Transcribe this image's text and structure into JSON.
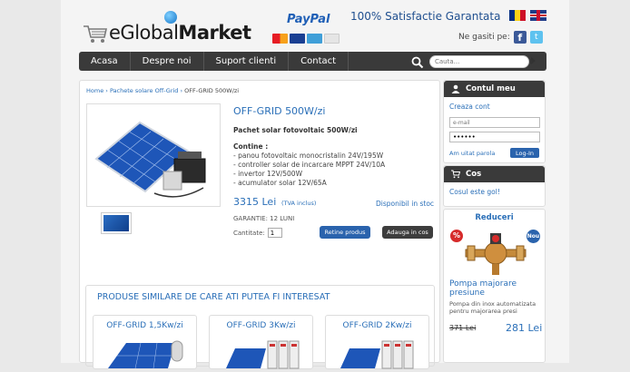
{
  "header": {
    "logo_part1": "eGlobal",
    "logo_part2": "Market",
    "paypal": "PayPal",
    "satisfaction": "100% Satisfactie Garantata",
    "social_label": "Ne gasiti pe:"
  },
  "nav": {
    "items": [
      "Acasa",
      "Despre noi",
      "Suport clienti",
      "Contact"
    ],
    "search_placeholder": "Cauta..."
  },
  "breadcrumb": {
    "home": "Home",
    "category": "Pachete solare Off-Grid",
    "current": "OFF-GRID 500W/zi"
  },
  "product": {
    "title": "OFF-GRID 500W/zi",
    "subtitle": "Pachet solar fotovoltaic 500W/zi",
    "contents_label": "Contine :",
    "contents": [
      "- panou fotovoltaic monocristalin 24V/195W",
      "- controller solar de incarcare MPPT 24V/10A",
      "- invertor 12V/500W",
      "- acumulator solar 12V/65A"
    ],
    "price": "3315 Lei",
    "vat_note": "(TVA inclus)",
    "stock": "Disponibil in stoc",
    "warranty": "GARANTIE: 12 LUNI",
    "quantity_label": "Cantitate:",
    "quantity_value": "1",
    "reserve_button": "Retine produs",
    "add_button": "Adauga in cos"
  },
  "similar": {
    "title": "PRODUSE SIMILARE DE CARE ATI PUTEA FI INTERESAT",
    "items": [
      "OFF-GRID 1,5Kw/zi",
      "OFF-GRID 3Kw/zi",
      "OFF-GRID 2Kw/zi"
    ]
  },
  "account": {
    "header": "Contul meu",
    "create": "Creaza cont",
    "email_placeholder": "e-mail",
    "password_value": "••••••",
    "forgot": "Am uitat parola",
    "login": "Log-In"
  },
  "cart": {
    "header": "Cos",
    "empty": "Cosul este gol!"
  },
  "offers": {
    "title": "Reduceri",
    "badge_pct": "%",
    "badge_new": "Nou",
    "name": "Pompa majorare presiune",
    "desc": "Pompa din inox automatizata pentru majorarea presi",
    "old_price": "371",
    "old_price_unit": "Lei",
    "new_price": "281 Lei"
  },
  "colors": {
    "accent": "#2a6fb8",
    "nav_bg": "#3a3a3a",
    "button_blue": "#2a63ad"
  }
}
